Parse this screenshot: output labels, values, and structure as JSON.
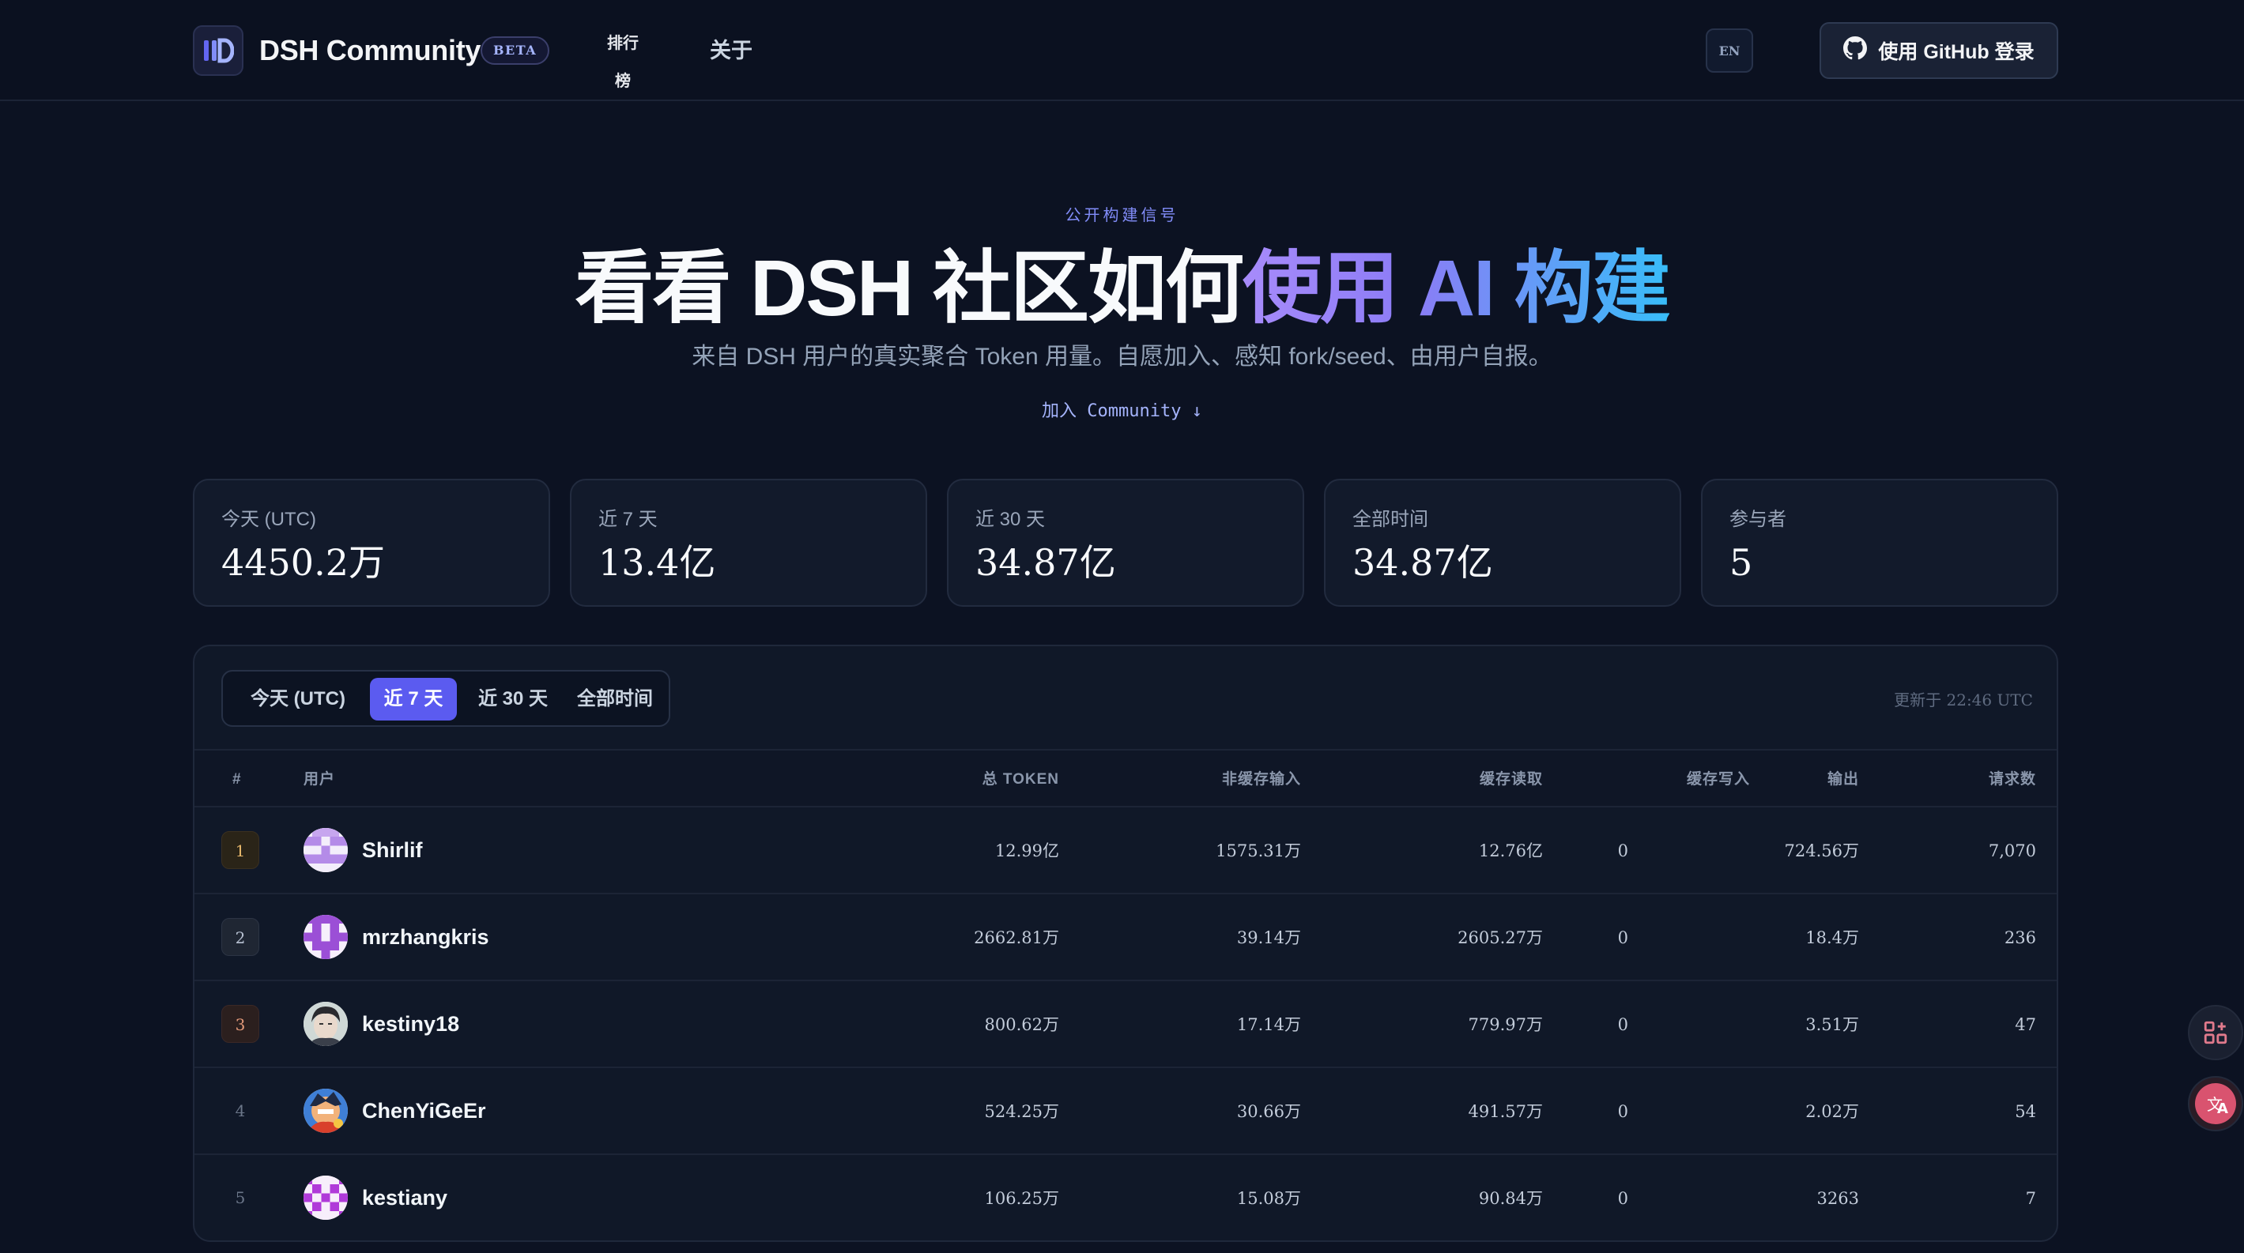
{
  "nav": {
    "brand": "DSH Community",
    "badge": "BETA",
    "links": [
      "排行榜",
      "关于"
    ],
    "lang": "EN",
    "login": "使用 GitHub 登录"
  },
  "hero": {
    "eyebrow": "公开构建信号",
    "title_plain": "看看 DSH 社区如何",
    "title_accent": "使用 AI 构建",
    "subtitle": "来自 DSH 用户的真实聚合 Token 用量。自愿加入、感知 fork/seed、由用户自报。",
    "join": "加入 Community ↓"
  },
  "stats": [
    {
      "label": "今天 (UTC)",
      "value": "4450.2万"
    },
    {
      "label": "近 7 天",
      "value": "13.4亿"
    },
    {
      "label": "近 30 天",
      "value": "34.87亿"
    },
    {
      "label": "全部时间",
      "value": "34.87亿"
    },
    {
      "label": "参与者",
      "value": "5"
    }
  ],
  "leaderboard": {
    "tabs": [
      "今天 (UTC)",
      "近 7 天",
      "近 30 天",
      "全部时间"
    ],
    "active_tab": "近 7 天",
    "updated": "更新于 22:46 UTC",
    "columns": [
      "#",
      "用户",
      "总 TOKEN",
      "非缓存输入",
      "缓存读取",
      "缓存写入",
      "输出",
      "请求数"
    ],
    "rows": [
      {
        "rank": "1",
        "user": "Shirlif",
        "total": "12.99亿",
        "uncached": "1575.31万",
        "cache_read": "12.76亿",
        "cache_write": "0",
        "output": "724.56万",
        "requests": "7,070"
      },
      {
        "rank": "2",
        "user": "mrzhangkris",
        "total": "2662.81万",
        "uncached": "39.14万",
        "cache_read": "2605.27万",
        "cache_write": "0",
        "output": "18.4万",
        "requests": "236"
      },
      {
        "rank": "3",
        "user": "kestiny18",
        "total": "800.62万",
        "uncached": "17.14万",
        "cache_read": "779.97万",
        "cache_write": "0",
        "output": "3.51万",
        "requests": "47"
      },
      {
        "rank": "4",
        "user": "ChenYiGeEr",
        "total": "524.25万",
        "uncached": "30.66万",
        "cache_read": "491.57万",
        "cache_write": "0",
        "output": "2.02万",
        "requests": "54"
      },
      {
        "rank": "5",
        "user": "kestiany",
        "total": "106.25万",
        "uncached": "15.08万",
        "cache_read": "90.84万",
        "cache_write": "0",
        "output": "3263",
        "requests": "7"
      }
    ]
  },
  "colors": {
    "background": "#0c1222",
    "accent": "#5b5bf0",
    "gradient_start": "#a78bfa",
    "gradient_end": "#38bdf8"
  },
  "icons": [
    "logo-icon",
    "github-icon",
    "apps-icon",
    "translate-icon"
  ]
}
